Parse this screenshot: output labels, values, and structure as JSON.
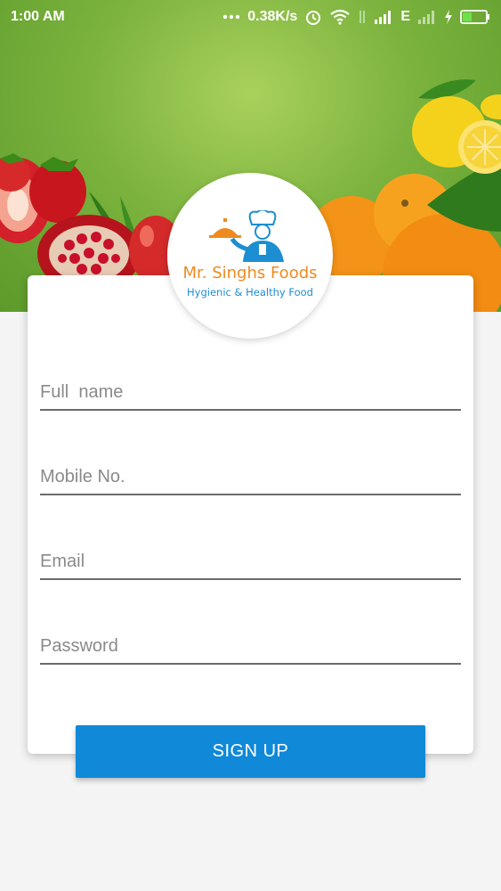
{
  "status_bar": {
    "time": "1:00 AM",
    "network_speed": "0.38K/s",
    "network_type": "E",
    "icons": [
      "more-dots-icon",
      "alarm-icon",
      "wifi-icon",
      "data-transfer-icon",
      "signal-icon",
      "signal-off-icon",
      "charging-icon",
      "battery-icon"
    ]
  },
  "logo": {
    "brand_name": "Mr. Singhs Foods",
    "tagline": "Hygienic & Healthy Food",
    "icon": "chef-serving-icon",
    "colors": {
      "brand": "#ef8a1e",
      "tagline": "#1d8ed1"
    }
  },
  "hero": {
    "images": [
      "strawberry-image",
      "pomegranate-image",
      "apple-image",
      "orange-image",
      "lemon-image"
    ],
    "background_color": "#7cb33e"
  },
  "form": {
    "full_name": {
      "placeholder": "Full  name",
      "value": ""
    },
    "mobile": {
      "placeholder": "Mobile No.",
      "value": ""
    },
    "email": {
      "placeholder": "Email",
      "value": ""
    },
    "password": {
      "placeholder": "Password",
      "value": ""
    },
    "submit_label": "SIGN UP",
    "accent_color": "#1089d8"
  }
}
